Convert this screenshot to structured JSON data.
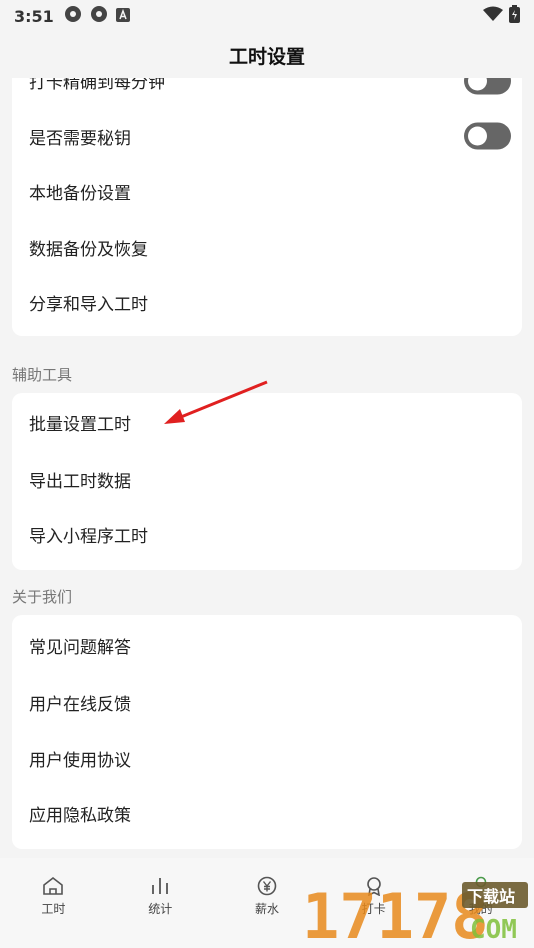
{
  "status_bar": {
    "time": "3:51"
  },
  "header": {
    "title": "工时设置"
  },
  "sections": {
    "general": {
      "items": [
        {
          "label": "打卡精确到每分钟",
          "toggle": true
        },
        {
          "label": "是否需要秘钥",
          "toggle": true
        },
        {
          "label": "本地备份设置"
        },
        {
          "label": "数据备份及恢复"
        },
        {
          "label": "分享和导入工时"
        }
      ]
    },
    "tools": {
      "title": "辅助工具",
      "items": [
        {
          "label": "批量设置工时"
        },
        {
          "label": "导出工时数据"
        },
        {
          "label": "导入小程序工时"
        }
      ]
    },
    "about": {
      "title": "关于我们",
      "items": [
        {
          "label": "常见问题解答"
        },
        {
          "label": "用户在线反馈"
        },
        {
          "label": "用户使用协议"
        },
        {
          "label": "应用隐私政策"
        }
      ]
    }
  },
  "tab_bar": {
    "tabs": [
      {
        "label": "工时",
        "icon": "home-icon"
      },
      {
        "label": "统计",
        "icon": "bar-chart-icon"
      },
      {
        "label": "薪水",
        "icon": "yen-icon"
      },
      {
        "label": "打卡",
        "icon": "badge-icon"
      },
      {
        "label": "我的",
        "icon": "user-icon"
      }
    ]
  },
  "watermark": {
    "number": "17178",
    "text": "下载站",
    "suffix": "COM"
  },
  "colors": {
    "background": "#f4f4f4",
    "card": "#ffffff",
    "toggle_off": "#666666",
    "arrow": "#e02020",
    "watermark_orange": "#e8891c"
  }
}
